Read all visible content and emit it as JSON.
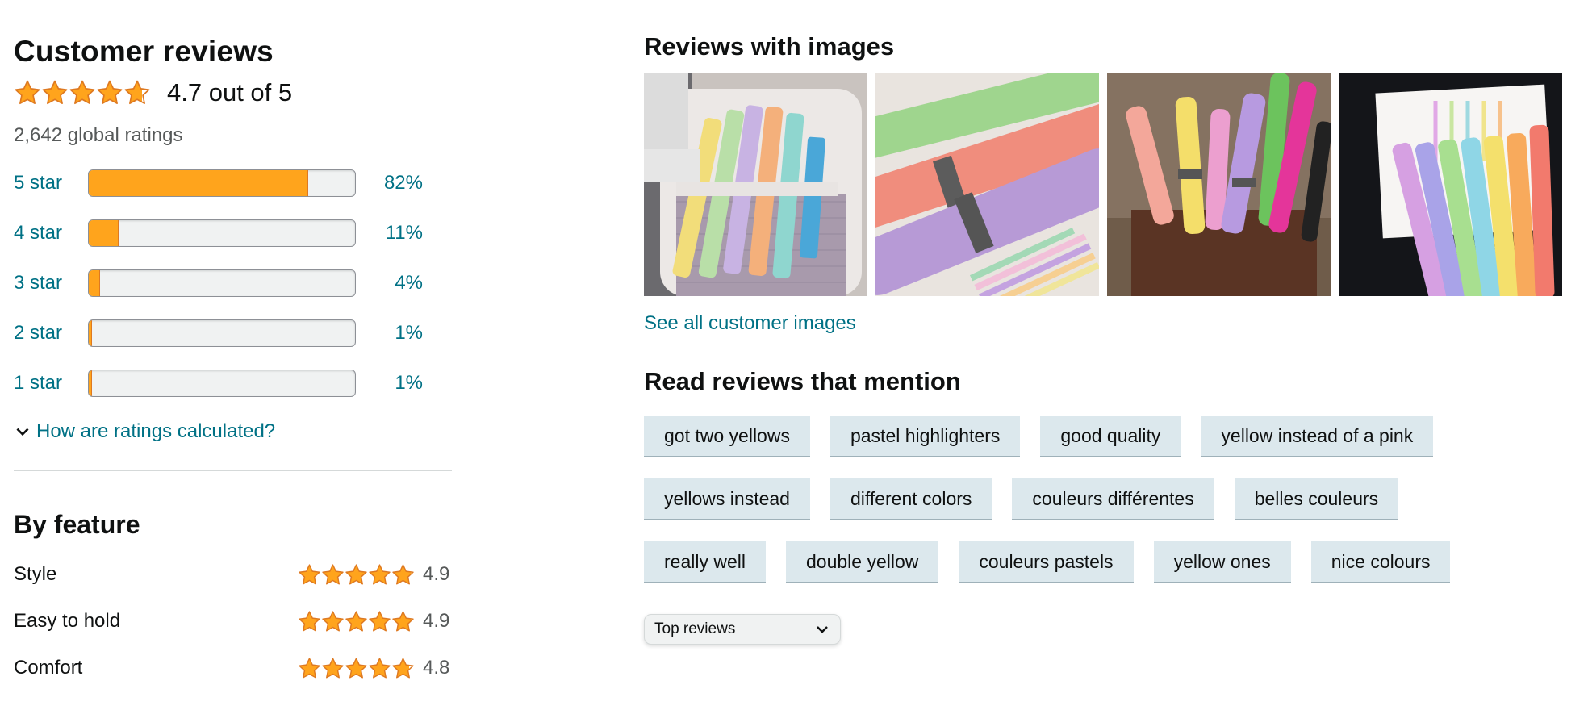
{
  "summary": {
    "title": "Customer reviews",
    "average_text": "4.7 out of 5",
    "average_rating": 4.7,
    "global_ratings": "2,642 global ratings",
    "star_color": "#ffa41c"
  },
  "histogram": [
    {
      "label": "5 star",
      "percent": "82%",
      "fraction": 0.82
    },
    {
      "label": "4 star",
      "percent": "11%",
      "fraction": 0.11
    },
    {
      "label": "3 star",
      "percent": "4%",
      "fraction": 0.04
    },
    {
      "label": "2 star",
      "percent": "1%",
      "fraction": 0.01
    },
    {
      "label": "1 star",
      "percent": "1%",
      "fraction": 0.01
    }
  ],
  "how_link": "How are ratings calculated?",
  "by_feature": {
    "title": "By feature",
    "items": [
      {
        "name": "Style",
        "value": "4.9",
        "rating": 4.9
      },
      {
        "name": "Easy to hold",
        "value": "4.9",
        "rating": 4.9
      },
      {
        "name": "Comfort",
        "value": "4.8",
        "rating": 4.8
      }
    ]
  },
  "images_section": {
    "title": "Reviews with images",
    "see_all": "See all customer images",
    "images": [
      "highlighters-in-pencil-case",
      "highlighters-closeup",
      "highlighters-in-wooden-holder",
      "highlighters-with-swatches"
    ]
  },
  "mentions": {
    "title": "Read reviews that mention",
    "rows": [
      [
        "got two yellows",
        "pastel highlighters",
        "good quality",
        "yellow instead of a pink"
      ],
      [
        "yellows instead",
        "different colors",
        "couleurs différentes",
        "belles couleurs"
      ],
      [
        "really well",
        "double yellow",
        "couleurs pastels",
        "yellow ones",
        "nice colours"
      ]
    ]
  },
  "sort": {
    "selected": "Top reviews"
  }
}
